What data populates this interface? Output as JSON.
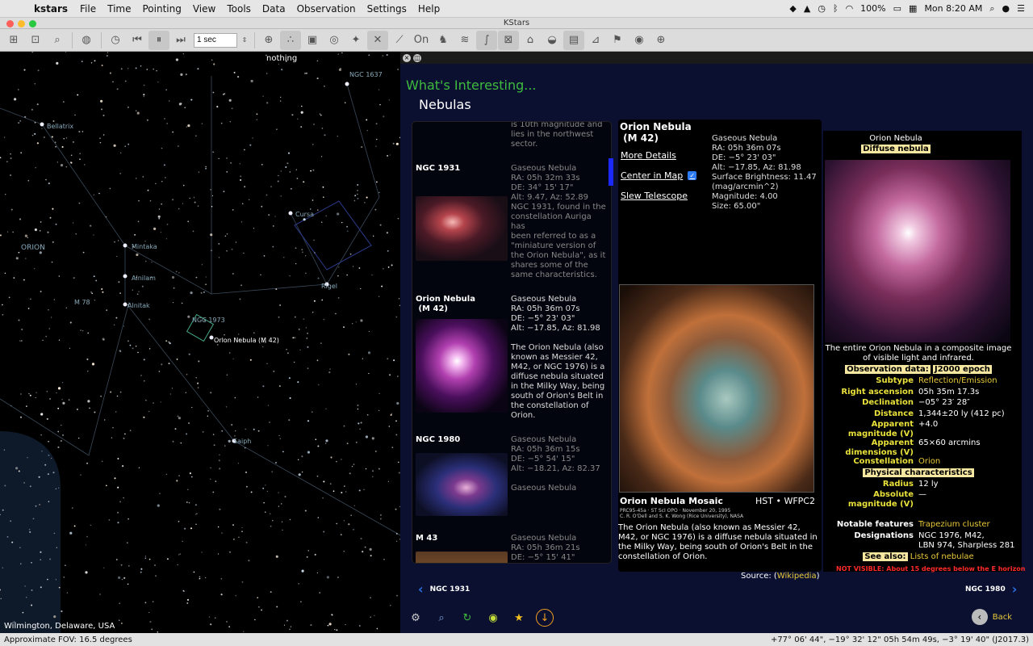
{
  "menubar": {
    "app": "kstars",
    "items": [
      "File",
      "Time",
      "Pointing",
      "View",
      "Tools",
      "Data",
      "Observation",
      "Settings",
      "Help"
    ],
    "battery": "100%",
    "clock": "Mon 8:20 AM"
  },
  "window": {
    "title": "KStars"
  },
  "toolbar": {
    "time_step": "1 sec"
  },
  "sky": {
    "top_label": "nothing",
    "location": "Wilmington, Delaware, USA",
    "labels": [
      "NGC 1637",
      "Bellatrix",
      "ORION",
      "Mintaka",
      "Alnilam",
      "M 78",
      "Alnitak",
      "NGC 1973",
      "Orion Nebula (M 42)",
      "Cursa",
      "Rigel",
      "Saiph"
    ]
  },
  "panel": {
    "header": "What's Interesting...",
    "category": "Nebulas"
  },
  "list": [
    {
      "name": "",
      "lines": [
        "is 10th magnitude and",
        "lies in the northwest",
        "sector."
      ]
    },
    {
      "name": "NGC 1931",
      "lines": [
        "Gaseous Nebula",
        "RA: 05h 32m 33s",
        "DE: 34° 15' 17\"",
        "Alt: 9.47, Az: 52.89",
        "",
        "NGC 1931, found in the",
        "constellation Auriga has",
        "been referred to as a",
        "\"miniature version of",
        "the Orion Nebula\", as it",
        "shares some of the",
        "same characteristics."
      ]
    },
    {
      "name": "Orion Nebula\n (M 42)",
      "lines": [
        "Gaseous Nebula",
        "RA: 05h 36m 07s",
        "DE: −5° 23' 03\"",
        "Alt: −17.85, Az: 81.98",
        "",
        "The Orion Nebula (also",
        "known as Messier 42,",
        "M42, or NGC 1976) is a",
        "diffuse nebula situated",
        "in the Milky Way, being",
        "south of Orion's Belt in",
        "the constellation of",
        "Orion."
      ]
    },
    {
      "name": "NGC 1980",
      "lines": [
        "Gaseous Nebula",
        "RA: 05h 36m 15s",
        "DE: −5° 54' 15\"",
        "Alt: −18.21, Az: 82.37",
        "",
        "Gaseous Nebula"
      ]
    },
    {
      "name": "M 43",
      "lines": [
        "Gaseous Nebula",
        "RA: 05h 36m 21s",
        "DE: −5° 15' 41\""
      ]
    }
  ],
  "detail": {
    "name": "Orion Nebula\n (M 42)",
    "links": [
      "More Details",
      "Center in Map",
      "Slew Telescope"
    ],
    "info": [
      "Gaseous Nebula",
      "RA: 05h 36m 07s",
      "DE: −5° 23' 03\"",
      "Alt: −17.85, Az: 81.98",
      "Surface Brightness: 11.47",
      "(mag/arcmin^2)",
      "Magnitude: 4.00",
      "Size: 65.00\""
    ],
    "mosaic_title": "Orion Nebula Mosaic",
    "mosaic_inst": "HST • WFPC2",
    "mosaic_small": [
      "PRC95-45a · ST ScI OPO · November 20, 1995",
      "C. R. O'Dell and S. K. Wong (Rice University), NASA"
    ],
    "desc": "The Orion Nebula (also known as Messier 42, M42, or NGC 1976) is a diffuse nebula situated in the Milky Way, being south of Orion's Belt in the constellation of Orion.",
    "source_label": "Source: (",
    "source_link": "Wikipedia",
    "source_end": ")"
  },
  "wiki": {
    "title": "Orion Nebula",
    "type": "Diffuse nebula",
    "caption": "The entire Orion Nebula in a composite image of visible light and infrared.",
    "obs_label": "Observation data:",
    "obs_epoch": "J2000 epoch",
    "rows": [
      {
        "k": "Subtype",
        "v": "Reflection/Emission"
      },
      {
        "k": "Right ascension",
        "v": "05h 35m 17.3s"
      },
      {
        "k": "Declination",
        "v": "−05° 23′ 28″"
      },
      {
        "k": "Distance",
        "v": "1,344±20 ly   (412 pc)"
      },
      {
        "k": "Apparent magnitude (V)",
        "v": "+4.0"
      },
      {
        "k": "Apparent dimensions (V)",
        "v": "65×60 arcmins"
      },
      {
        "k": "Constellation",
        "v": "Orion"
      }
    ],
    "phys": "Physical characteristics",
    "rows2": [
      {
        "k": "Radius",
        "v": "12 ly"
      },
      {
        "k": "Absolute magnitude (V)",
        "v": "—"
      }
    ],
    "notable_k": "Notable features",
    "notable_v": "Trapezium cluster",
    "desig_k": "Designations",
    "desig_v": "NGC 1976, M42,",
    "desig_v2": "LBN 974, Sharpless 281",
    "see_k": "See also:",
    "see_v": "Lists of nebulae"
  },
  "notvis": "NOT VISIBLE: About 15 degrees below the E horizon",
  "nav": {
    "prev": "NGC 1931",
    "next": "NGC 1980",
    "back": "Back"
  },
  "status": {
    "fov": "Approximate FOV: 16.5 degrees",
    "coords": "+77° 06' 44\", −19° 32' 12\"  05h 54m 49s, −3° 19' 40\" (J2017.3)"
  }
}
